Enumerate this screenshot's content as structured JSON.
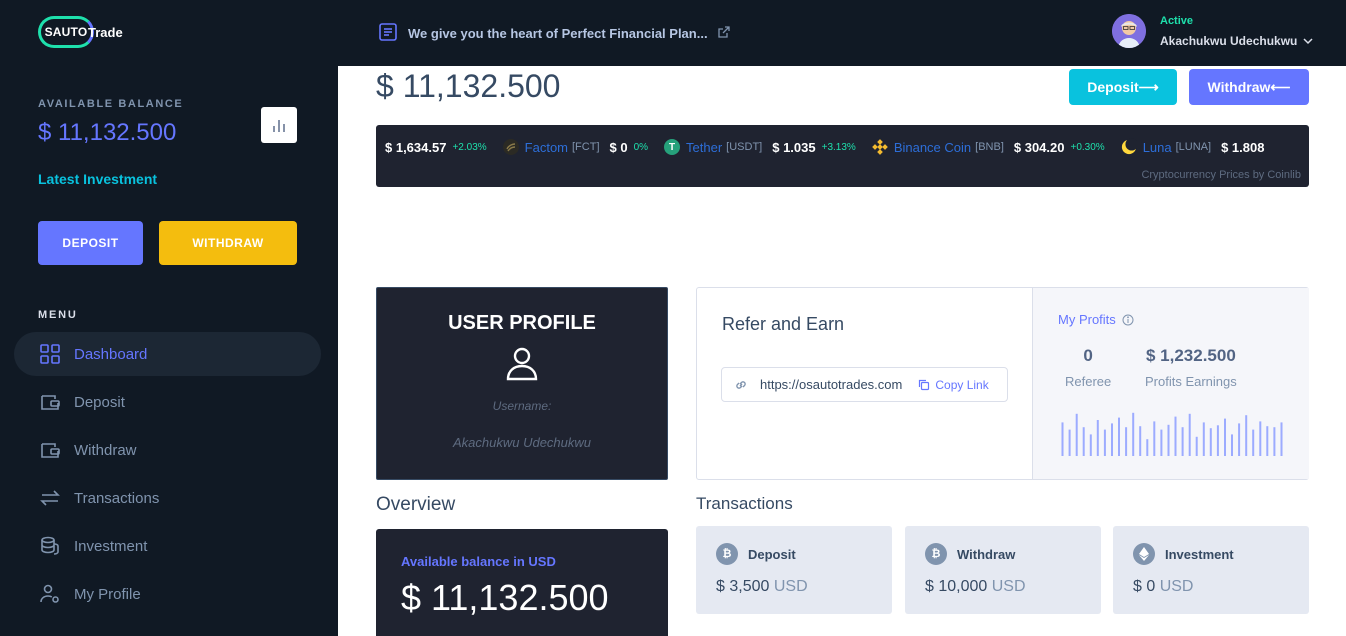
{
  "brand": {
    "logo_mark": "SAUTO",
    "logo_text": "Trade"
  },
  "colors": {
    "accent": "#6576ff",
    "info": "#09c2de",
    "warning": "#f4bd0e",
    "success": "#1ee0ac",
    "dark": "#101924"
  },
  "sidebar": {
    "balance_label": "AVAILABLE BALANCE",
    "balance_value": "$ 11,132.500",
    "latest_investment": "Latest Investment",
    "deposit_label": "DEPOSIT",
    "withdraw_label": "WITHDRAW",
    "menu_label": "MENU",
    "items": [
      {
        "label": "Dashboard",
        "icon": "dashboard-icon",
        "active": true
      },
      {
        "label": "Deposit",
        "icon": "wallet-in-icon"
      },
      {
        "label": "Withdraw",
        "icon": "wallet-out-icon"
      },
      {
        "label": "Transactions",
        "icon": "transfer-icon"
      },
      {
        "label": "Investment",
        "icon": "coins-icon"
      },
      {
        "label": "My Profile",
        "icon": "user-settings-icon"
      }
    ]
  },
  "header": {
    "news": "We give you the heart of Perfect Financial Plan...",
    "user_status": "Active",
    "user_name": "Akachukwu Udechukwu"
  },
  "main": {
    "balance": "$ 11,132.500",
    "deposit_label": "Deposit⟶",
    "withdraw_label": "Withdraw⟵"
  },
  "ticker": {
    "first_price": "$ 1,634.57",
    "first_change": "+2.03%",
    "items": [
      {
        "name": "Factom",
        "symbol": "[FCT]",
        "price": "$ 0",
        "change": "0%"
      },
      {
        "name": "Tether",
        "symbol": "[USDT]",
        "price": "$ 1.035",
        "change": "+3.13%"
      },
      {
        "name": "Binance Coin",
        "symbol": "[BNB]",
        "price": "$ 304.20",
        "change": "+0.30%"
      },
      {
        "name": "Luna",
        "symbol": "[LUNA]",
        "price": "$ 1.808",
        "change": ""
      }
    ],
    "credit": "Cryptocurrency Prices by Coinlib"
  },
  "profile": {
    "title": "USER PROFILE",
    "username_label": "Username:",
    "username": "Akachukwu Udechukwu"
  },
  "refer": {
    "title": "Refer and Earn",
    "url": "https://osautotrades.com",
    "copy_label": "Copy Link"
  },
  "profits": {
    "title": "My Profits",
    "referee_value": "0",
    "referee_label": "Referee",
    "earnings_value": "$ 1,232.500",
    "earnings_label": "Profits Earnings",
    "sparkline": [
      0.7,
      0.55,
      0.88,
      0.6,
      0.45,
      0.75,
      0.55,
      0.68,
      0.8,
      0.6,
      0.9,
      0.62,
      0.35,
      0.72,
      0.55,
      0.65,
      0.82,
      0.6,
      0.88,
      0.4,
      0.7,
      0.58,
      0.64,
      0.78,
      0.45,
      0.68,
      0.85,
      0.55,
      0.72,
      0.62,
      0.6,
      0.7
    ]
  },
  "overview": {
    "title": "Overview",
    "label": "Available balance in USD",
    "value": "$ 11,132.500"
  },
  "transactions": {
    "title": "Transactions",
    "cards": [
      {
        "label": "Deposit",
        "icon": "bitcoin-icon",
        "amount": "$ 3,500",
        "currency": "USD"
      },
      {
        "label": "Withdraw",
        "icon": "bitcoin-icon",
        "amount": "$ 10,000",
        "currency": "USD"
      },
      {
        "label": "Investment",
        "icon": "ethereum-icon",
        "amount": "$ 0",
        "currency": "USD"
      }
    ]
  }
}
